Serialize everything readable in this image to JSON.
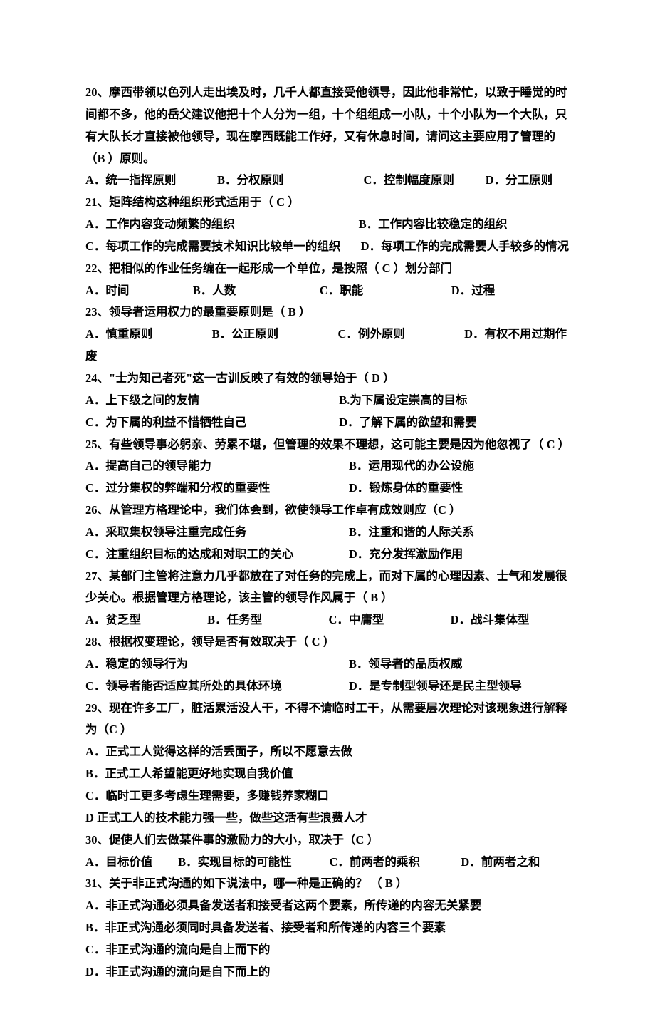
{
  "questions": [
    {
      "num": "20",
      "stem": "20、摩西带领以色列人走出埃及时，几千人都直接受他领导，因此他非常忙，以致于睡觉的时间都不多，他的岳父建议他把十个人分为一组，十个组组成一小队，十个小队为一个大队，只有大队长才直接被他领导，现在摩西既能工作好，又有休息时间，请问这主要应用了管理的（B  ）原则。",
      "opts": {
        "a": "A．统一指挥原则",
        "b": "B．分权原则",
        "c": "C．控制幅度原则",
        "d": "D．分工原则"
      }
    },
    {
      "num": "21",
      "stem": "21、矩阵结构这种组织形式适用于（ C ）",
      "opts": {
        "a": "A．工作内容变动频繁的组织",
        "b": "B．工作内容比较稳定的组织",
        "c": "C．每项工作的完成需要技术知识比较单一的组织",
        "d": "D．每项工作的完成需要人手较多的情况"
      }
    },
    {
      "num": "22",
      "stem": "22、把相似的作业任务编在一起形成一个单位，是按照（ C ）划分部门",
      "opts": {
        "a": "A．时间",
        "b": "B．人数",
        "c": "C．职能",
        "d": "D．过程"
      }
    },
    {
      "num": "23",
      "stem": "23、领导者运用权力的最重要原则是（ B ）",
      "opts": {
        "a": "A．慎重原则",
        "b": "B．公正原则",
        "c": "C．例外原则",
        "d": "D．有权不用过期作废"
      }
    },
    {
      "num": "24",
      "stem": "24、\"士为知己者死\"这一古训反映了有效的领导始于（ D ）",
      "opts": {
        "a": "A．上下级之间的友情",
        "b": "B.为下属设定崇高的目标",
        "c": "C．为下属的利益不惜牺牲自己",
        "d": "D．了解下属的欲望和需要"
      }
    },
    {
      "num": "25",
      "stem": "25、有些领导事必躬亲、劳累不堪，但管理的效果不理想，这可能主要是因为他忽视了（ C ）",
      "opts": {
        "a": "A．提高自己的领导能力",
        "b": "B．运用现代的办公设施",
        "c": "C．过分集权的弊端和分权的重要性",
        "d": "D．锻炼身体的重要性"
      }
    },
    {
      "num": "26",
      "stem": "26、从管理方格理论中，我们体会到，欲使领导工作卓有成效则应（C  ）",
      "opts": {
        "a": "A．采取集权领导注重完成任务",
        "b": "B．注重和谐的人际关系",
        "c": "C．注重组织目标的达成和对职工的关心",
        "d": "D．充分发挥激励作用"
      }
    },
    {
      "num": "27",
      "stem": "27、某部门主管将注意力几乎都放在了对任务的完成上，而对下属的心理因素、士气和发展很少关心。根据管理方格理论，该主管的领导作风属于（ B ）",
      "opts": {
        "a": "A．贫乏型",
        "b": "B．任务型",
        "c": "C．中庸型",
        "d": "D．战斗集体型"
      }
    },
    {
      "num": "28",
      "stem": "28、根据权变理论，领导是否有效取决于（ C ）",
      "opts": {
        "a": "A．稳定的领导行为",
        "b": "B．领导者的品质权威",
        "c": "C．领导者能否适应其所处的具体环境",
        "d": "D．是专制型领导还是民主型领导"
      }
    },
    {
      "num": "29",
      "stem": "29、现在许多工厂，脏活累活没人干，不得不请临时工干，从需要层次理论对该现象进行解释为（C  ）",
      "opts": {
        "a": "A．正式工人觉得这样的活丢面子，所以不愿意去做",
        "b": "B．正式工人希望能更好地实现自我价值",
        "c": "C．临时工更多考虑生理需要，多赚钱养家糊口",
        "d": "D 正式工人的技术能力强一些，做些这活有些浪费人才"
      }
    },
    {
      "num": "30",
      "stem": "30、促使人们去做某件事的激励力的大小，取决于（C  ）",
      "opts": {
        "a": "A．目标价值",
        "b": "B．实现目标的可能性",
        "c": "C．前两者的乘积",
        "d": "D．前两者之和"
      }
    },
    {
      "num": "31",
      "stem": "31、关于非正式沟通的如下说法中，哪一种是正确的？ （ B ）",
      "opts": {
        "a": "A．非正式沟通必须具备发送者和接受者这两个要素，所传递的内容无关紧要",
        "b": "B．非正式沟通必须同时具备发送者、接受者和所传递的内容三个要素",
        "c": "C．非正式沟通的流向是自上而下的",
        "d": "D．非正式沟通的流向是自下而上的"
      }
    }
  ]
}
